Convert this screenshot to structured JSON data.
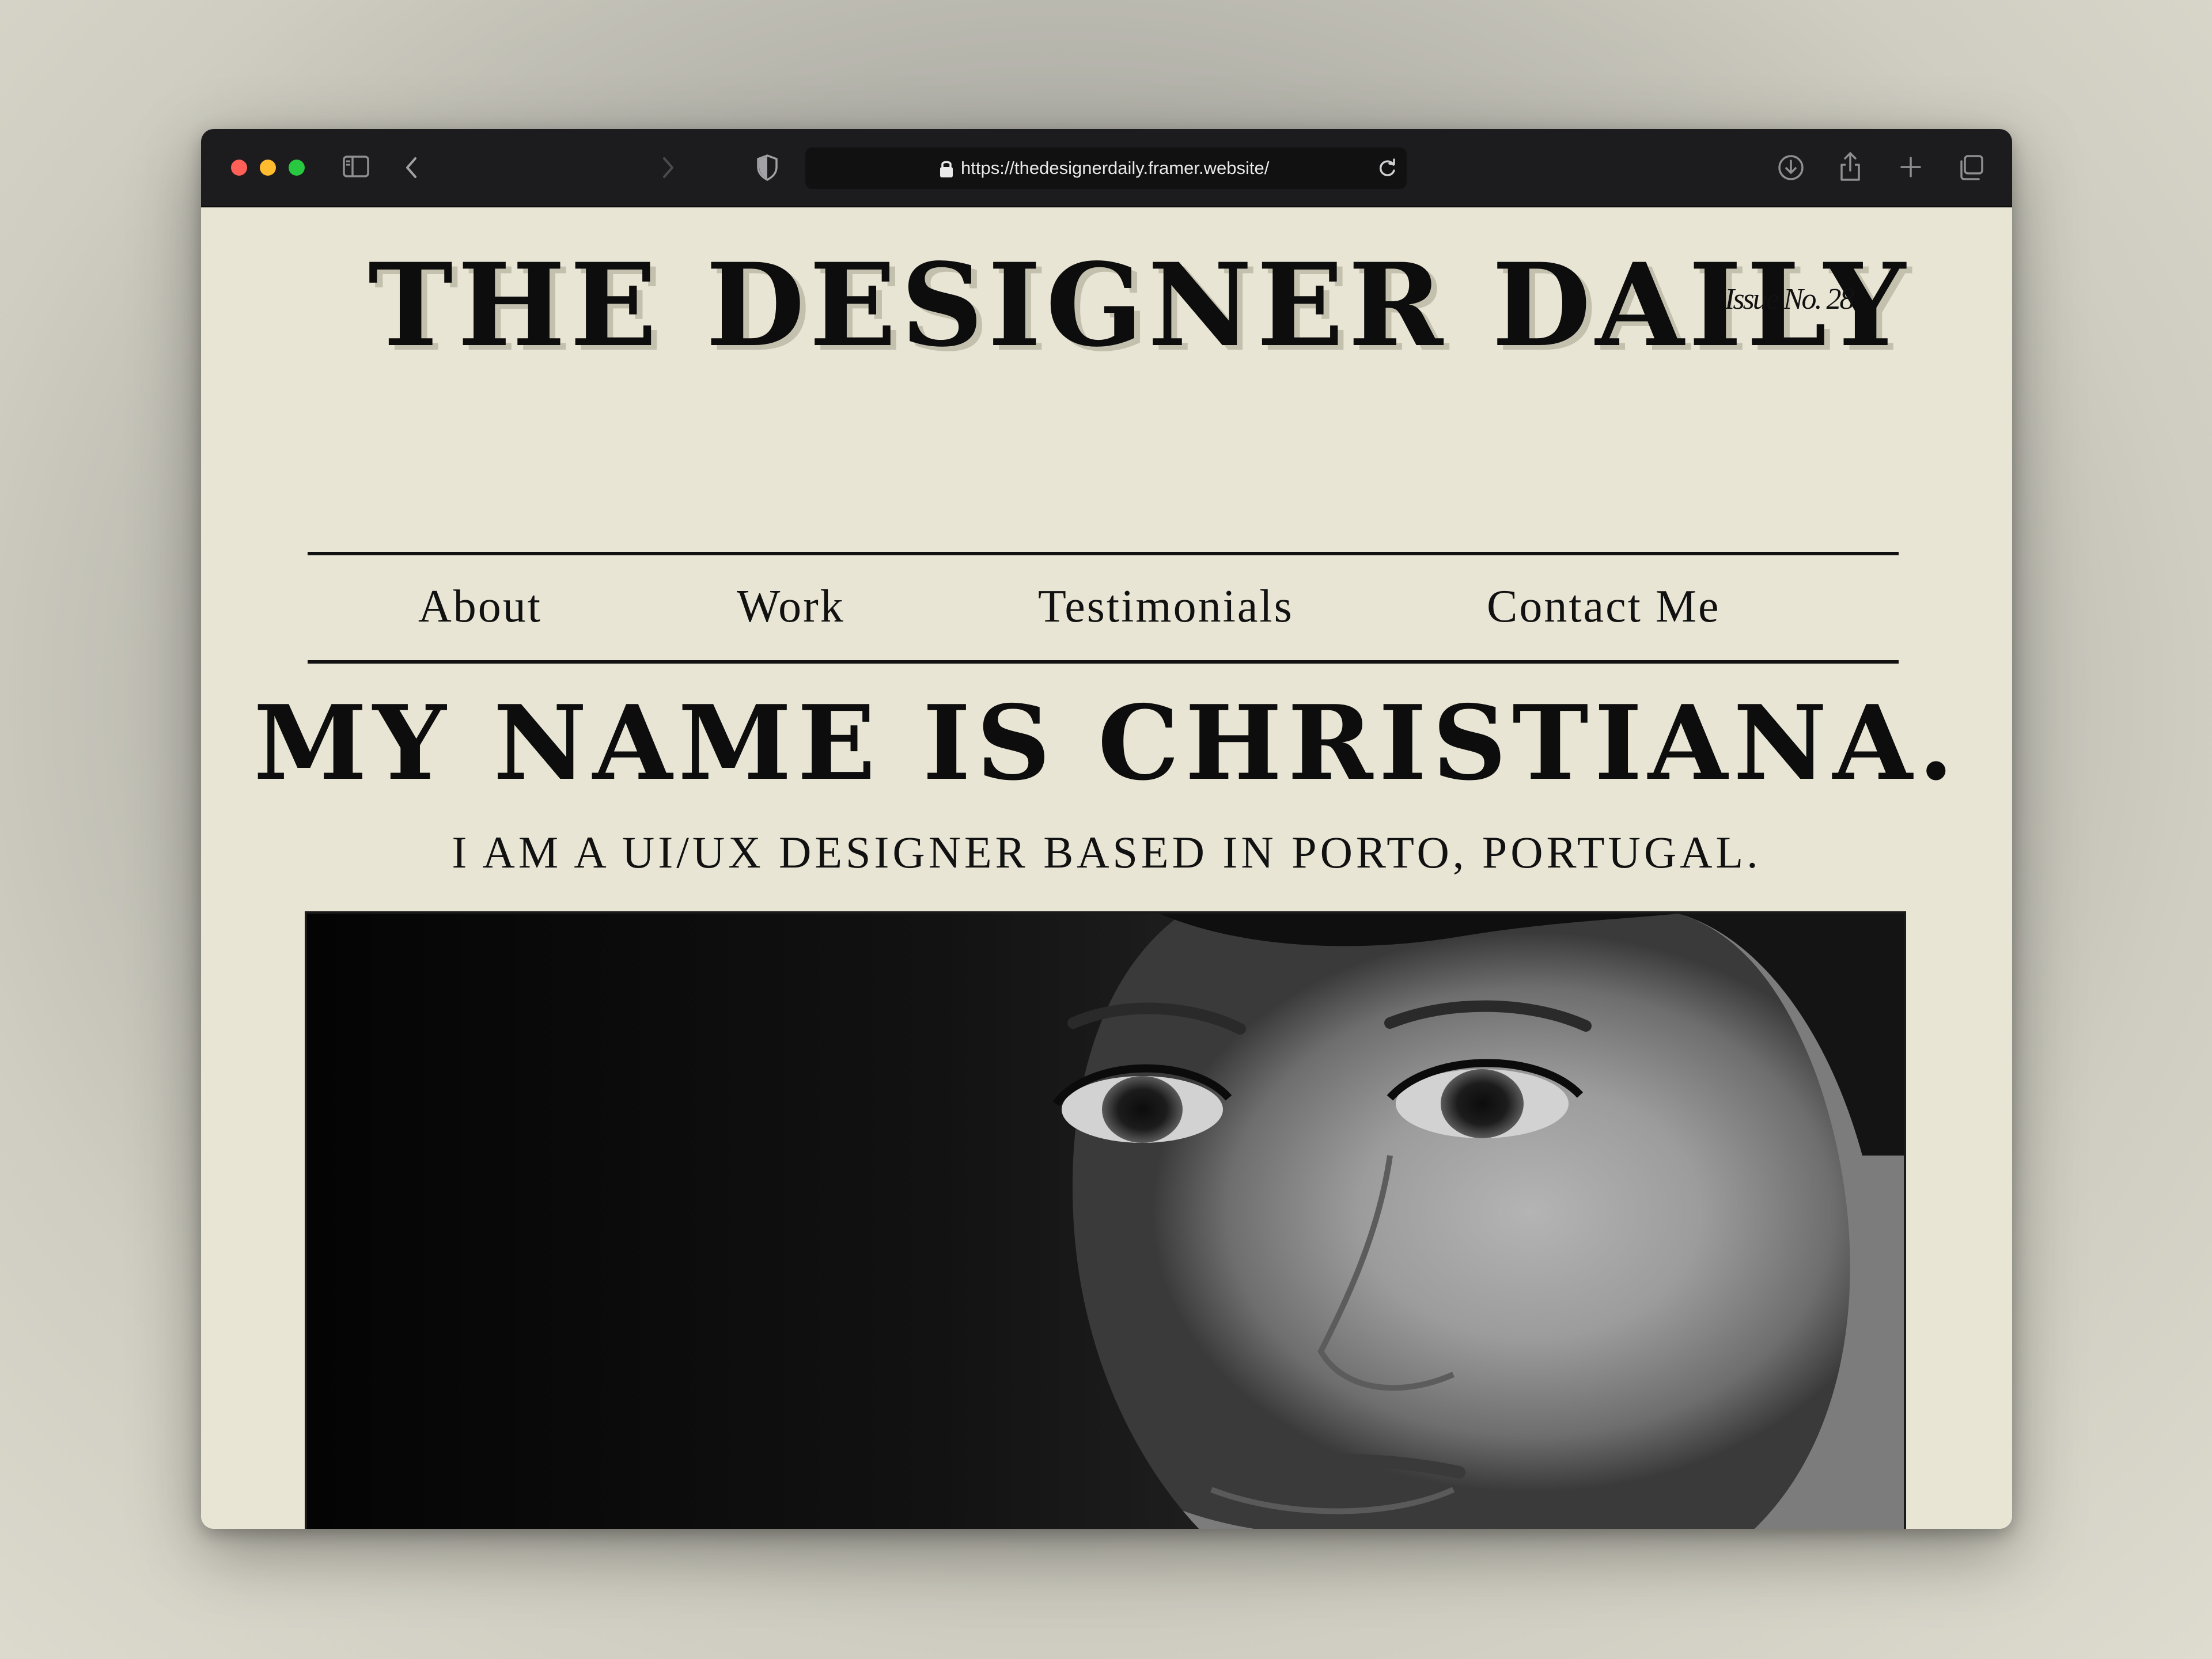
{
  "browser": {
    "url": "https://thedesignerdaily.framer.website/"
  },
  "site": {
    "title": "THE DESIGNER DAILY",
    "issue": "Issue No. 28"
  },
  "nav": {
    "items": [
      {
        "label": "About"
      },
      {
        "label": "Work"
      },
      {
        "label": "Testimonials"
      },
      {
        "label": "Contact Me"
      }
    ]
  },
  "hero": {
    "headline": "MY NAME IS CHRISTIANA.",
    "subheadline": "I AM A UI/UX DESIGNER BASED IN PORTO, PORTUGAL."
  },
  "colors": {
    "page_background": "#e8e5d5",
    "toolbar": "#1c1c1e",
    "ink": "#111111"
  },
  "icons": [
    "sidebar-icon",
    "back-icon",
    "forward-icon",
    "privacy-shield-icon",
    "lock-icon",
    "reload-icon",
    "download-icon",
    "share-icon",
    "new-tab-icon",
    "tabs-overview-icon"
  ]
}
